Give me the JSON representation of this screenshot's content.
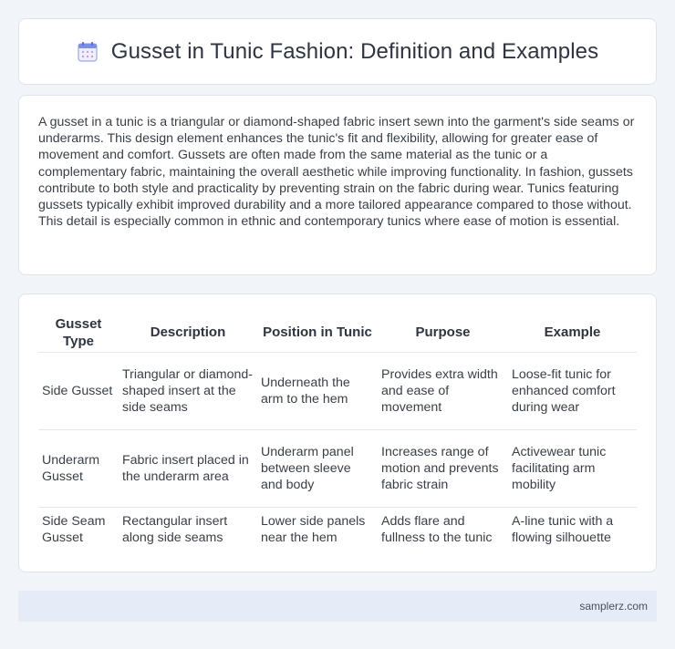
{
  "header": {
    "title": "Gusset in Tunic Fashion: Definition and Examples",
    "icon": "calendar-icon"
  },
  "description": {
    "text": "A gusset in a tunic is a triangular or diamond-shaped fabric insert sewn into the garment's side seams or underarms. This design element enhances the tunic's fit and flexibility, allowing for greater ease of movement and comfort. Gussets are often made from the same material as the tunic or a complementary fabric, maintaining the overall aesthetic while improving functionality. In fashion, gussets contribute to both style and practicality by preventing strain on the fabric during wear. Tunics featuring gussets typically exhibit improved durability and a more tailored appearance compared to those without. This detail is especially common in ethnic and contemporary tunics where ease of motion is essential."
  },
  "table": {
    "headers": [
      "Gusset Type",
      "Description",
      "Position in Tunic",
      "Purpose",
      "Example"
    ],
    "rows": [
      [
        "Side Gusset",
        "Triangular or diamond-shaped insert at the side seams",
        "Underneath the arm to the hem",
        "Provides extra width and ease of movement",
        "Loose-fit tunic for enhanced comfort during wear"
      ],
      [
        "Underarm Gusset",
        "Fabric insert placed in the underarm area",
        "Underarm panel between sleeve and body",
        "Increases range of motion and prevents fabric strain",
        "Activewear tunic facilitating arm mobility"
      ],
      [
        "Side Seam Gusset",
        "Rectangular insert along side seams",
        "Lower side panels near the hem",
        "Adds flare and fullness to the tunic",
        "A-line tunic with a flowing silhouette"
      ]
    ]
  },
  "footer": {
    "site": "samplerz.com"
  },
  "colors": {
    "background": "#f1f4f9",
    "card": "#ffffff",
    "footer": "#e6ecf7",
    "icon_accent": "#7b8fe0"
  }
}
